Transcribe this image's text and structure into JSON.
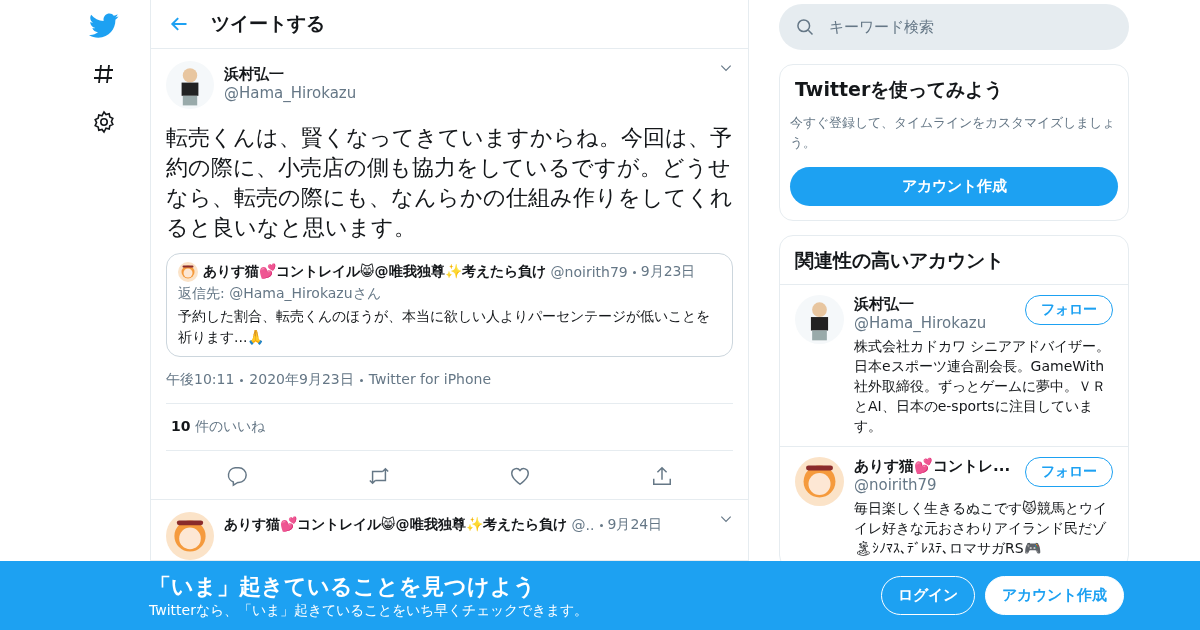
{
  "header": {
    "title": "ツイートする"
  },
  "tweet": {
    "name": "浜村弘一",
    "handle": "@Hama_Hirokazu",
    "text": "転売くんは、賢くなってきていますからね。今回は、予約の際に、小売店の側も協力をしているですが。どうせなら、転売の際にも、なんらかの仕組み作りをしてくれると良いなと思います。",
    "quote": {
      "name": "ありす猫💕コントレイル😸@唯我独尊✨考えたら負け",
      "handle": "@noirith79",
      "date": "9月23日",
      "reply_label": "返信先:",
      "reply_to": "@Hama_Hirokazuさん",
      "text": "予約した割合、転売くんのほうが、本当に欲しい人よりパーセンテージが低いことを祈ります...🙏"
    },
    "meta": [
      "午後10:11",
      "2020年9月23日",
      "Twitter for iPhone"
    ],
    "likes": {
      "count": "10",
      "label": "件のいいね"
    }
  },
  "reply": {
    "name": "ありす猫💕コントレイル😸@唯我独尊✨考えたら負け",
    "handle": "@..",
    "date": "9月24日"
  },
  "search": {
    "placeholder": "キーワード検索"
  },
  "signup": {
    "title": "Twitterを使ってみよう",
    "text": "今すぐ登録して、タイムラインをカスタマイズしましょう。",
    "button": "アカウント作成"
  },
  "related": {
    "title": "関連性の高いアカウント",
    "accounts": [
      {
        "name": "浜村弘一",
        "handle": "@Hama_Hirokazu",
        "button": "フォロー",
        "bio": "株式会社カドカワ シニアアドバイザー。日本eスポーツ連合副会長。GameWith 社外取締役。ずっとゲームに夢中。ＶＲとAI、日本のe-sportsに注目しています。"
      },
      {
        "name": "ありす猫💕コントレ...",
        "handle": "@noirith79",
        "button": "フォロー",
        "bio": "毎日楽しく生きるぬこです😾競馬とウイイレ好きな元おさわりアイランド民だゾ🏝ｼﾉﾏｽ､ﾃﾞﾚｽﾃ､ロマサガRS🎮"
      }
    ]
  },
  "banner": {
    "title": "「いま」起きていることを見つけよう",
    "text": "Twitterなら、「いま」起きていることをいち早くチェックできます。",
    "login": "ログイン",
    "signup": "アカウント作成"
  }
}
